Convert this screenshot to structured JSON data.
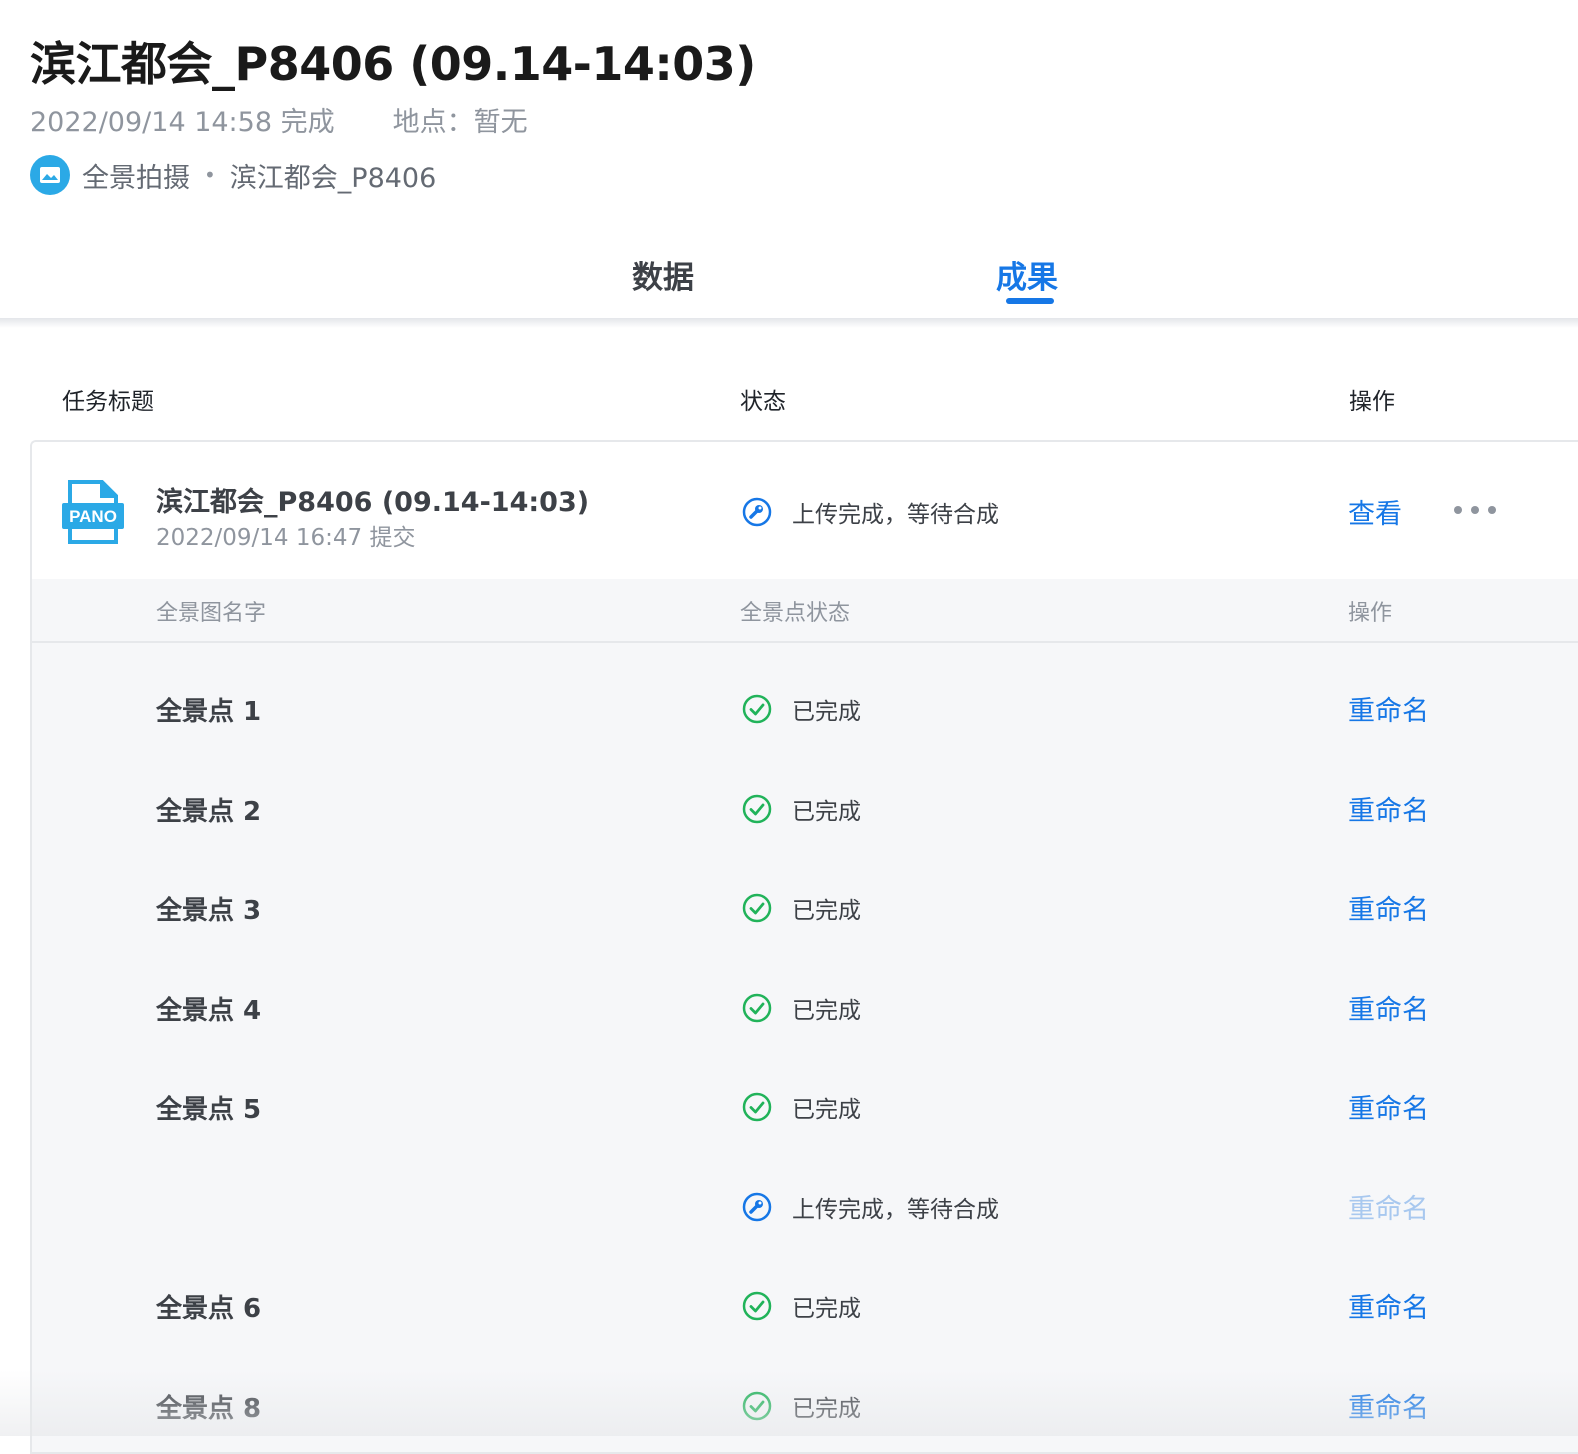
{
  "header": {
    "title": "滨江都会_P8406 (09.14-14:03)",
    "time": "2022/09/14 14:58 完成",
    "location": "地点：暂无",
    "app_name": "全景拍摄",
    "project": "滨江都会_P8406"
  },
  "tabs": [
    {
      "label": "数据",
      "active": false
    },
    {
      "label": "成果",
      "active": true
    }
  ],
  "table": {
    "columns": {
      "title": "任务标题",
      "status": "状态",
      "action": "操作"
    },
    "task": {
      "icon_text": "PANO",
      "title": "滨江都会_P8406 (09.14-14:03)",
      "subtitle": "2022/09/14 16:47 提交",
      "status": "上传完成，等待合成",
      "view": "查看"
    },
    "sub_columns": {
      "name": "全景图名字",
      "status": "全景点状态",
      "action": "操作"
    },
    "points": [
      {
        "name": "全景点 1",
        "status": "已完成",
        "action": "重命名",
        "state": "done"
      },
      {
        "name": "全景点 2",
        "status": "已完成",
        "action": "重命名",
        "state": "done"
      },
      {
        "name": "全景点 3",
        "status": "已完成",
        "action": "重命名",
        "state": "done"
      },
      {
        "name": "全景点 4",
        "status": "已完成",
        "action": "重命名",
        "state": "done"
      },
      {
        "name": "全景点 5",
        "status": "已完成",
        "action": "重命名",
        "state": "done"
      },
      {
        "name": "",
        "status": "上传完成，等待合成",
        "action": "重命名",
        "state": "pending"
      },
      {
        "name": "全景点 6",
        "status": "已完成",
        "action": "重命名",
        "state": "done"
      },
      {
        "name": "全景点 8",
        "status": "已完成",
        "action": "重命名",
        "state": "done"
      }
    ]
  },
  "colors": {
    "accent": "#1677e6",
    "success": "#21b35a",
    "pano": "#2ba9e6"
  }
}
